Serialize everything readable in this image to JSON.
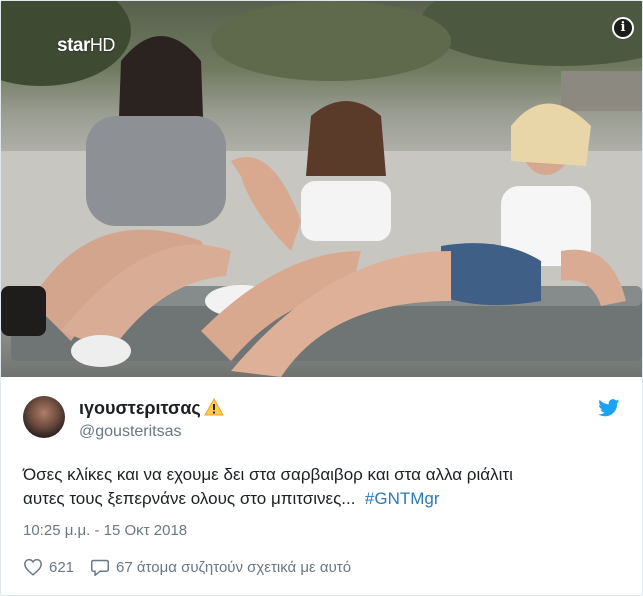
{
  "media": {
    "watermark_brand": "star",
    "watermark_suffix": "HD",
    "info_glyph": "i"
  },
  "author": {
    "display_name": "ιγουστεριτσας",
    "badge_icon": "warning-icon",
    "handle": "@gousteritsas",
    "avatar_alt": "avatar"
  },
  "tweet": {
    "line1": "Όσες κλίκες και να εχουμε δει στα σαρβαιβορ και στα αλλα ριάλιτι",
    "line2": "αυτες τους ξεπερνάνε ολους στο μπιτσινες...",
    "hashtag": "#GNTMgr",
    "timestamp": "10:25 μ.μ. - 15 Οκτ 2018"
  },
  "actions": {
    "likes": "621",
    "conversation": "67 άτομα συζητούν σχετικά με αυτό"
  },
  "colors": {
    "accent": "#1da1f2",
    "hashtag": "#2b7bb9",
    "muted": "#697882",
    "warning": "#ffcc4d"
  }
}
